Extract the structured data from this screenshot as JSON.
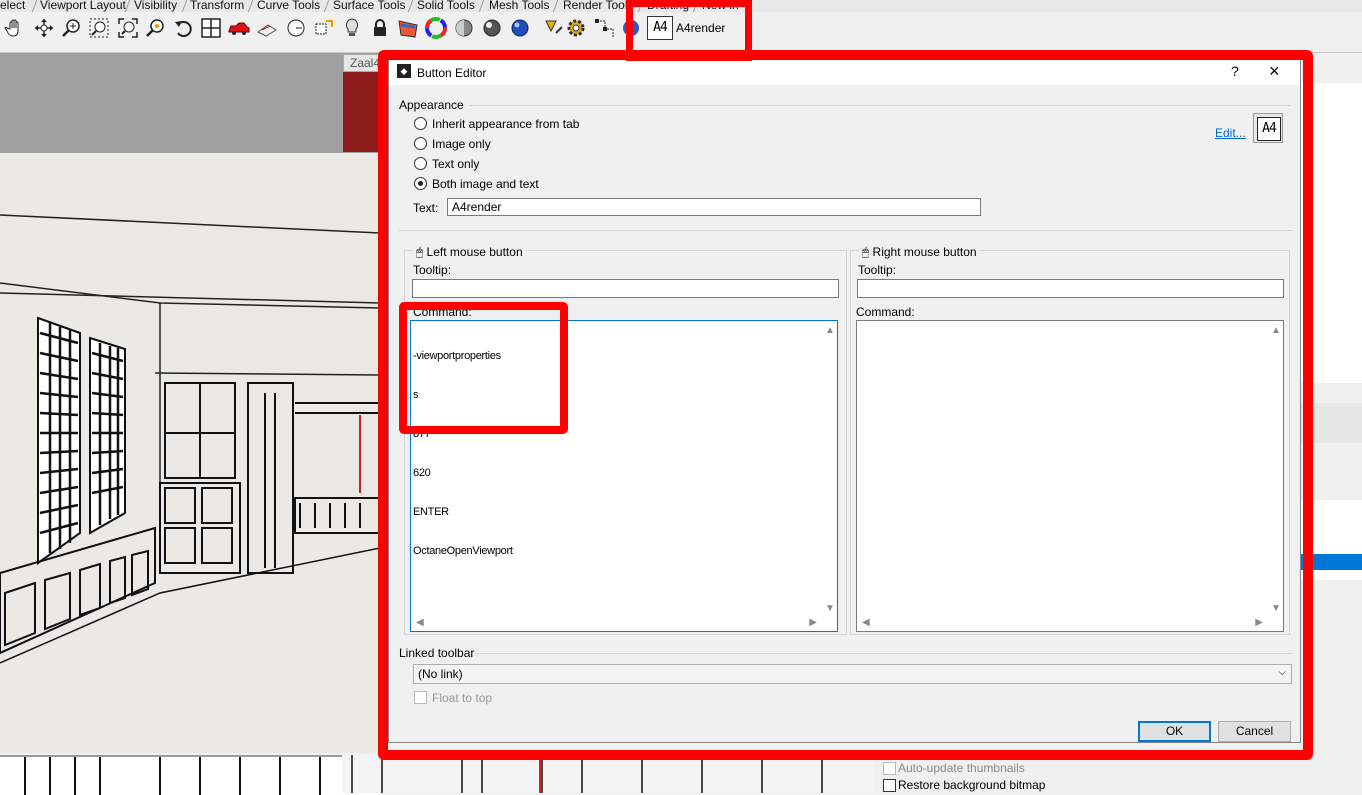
{
  "tabs": [
    "elect",
    "Viewport Layout",
    "Visibility",
    "Transform",
    "Curve Tools",
    "Surface Tools",
    "Solid Tools",
    "Mesh Tools",
    "Render Tools",
    "Drafting",
    "New in"
  ],
  "toolbar": {
    "custom_button_icon_text": "A4",
    "custom_button_label": "A4render",
    "icons": [
      "pan-icon",
      "rotate-view-icon",
      "zoom-icon",
      "zoom-window-icon",
      "zoom-extents-icon",
      "zoom-selected-icon",
      "undo-view-icon",
      "four-viewports-icon",
      "car-icon",
      "perspective-icon",
      "clock-icon",
      "named-position-icon",
      "lightbulb-icon",
      "lock-icon",
      "render-color-icon",
      "color-wheel-icon",
      "shaded-sphere-icon",
      "rendered-sphere-icon",
      "blue-sphere-icon",
      "pencil-icon",
      "gear-icon",
      "gumball-icon",
      "globe-icon"
    ]
  },
  "viewport": {
    "tab_label": "Zaal4"
  },
  "dialog": {
    "title": "Button Editor",
    "help": "?",
    "close": "×",
    "appearance": {
      "group_label": "Appearance",
      "options": [
        {
          "label": "Inherit appearance from tab",
          "checked": false
        },
        {
          "label": "Image only",
          "checked": false
        },
        {
          "label": "Text only",
          "checked": false
        },
        {
          "label": "Both image and text",
          "checked": true
        }
      ],
      "edit_link": "Edit...",
      "icon_preview_text": "A4",
      "text_label": "Text:",
      "text_value": "A4render"
    },
    "left_mouse": {
      "label": "Left mouse button",
      "tooltip_label": "Tooltip:",
      "tooltip_value": "",
      "command_label": "Command:",
      "command_lines": [
        "-viewportproperties",
        "s",
        "877",
        "620",
        "ENTER",
        "OctaneOpenViewport"
      ]
    },
    "right_mouse": {
      "label": "Right mouse button",
      "tooltip_label": "Tooltip:",
      "tooltip_value": "",
      "command_label": "Command:",
      "command_lines": []
    },
    "linked_toolbar": {
      "label": "Linked toolbar",
      "value": "(No link)",
      "float_label": "Float to top"
    },
    "ok_label": "OK",
    "cancel_label": "Cancel"
  },
  "right_panel": {
    "auto_update_label": "Auto-update thumbnails",
    "restore_label": "Restore background bitmap"
  },
  "colors": {
    "highlight": "#ff0000",
    "selection_blue": "#0078d7"
  }
}
